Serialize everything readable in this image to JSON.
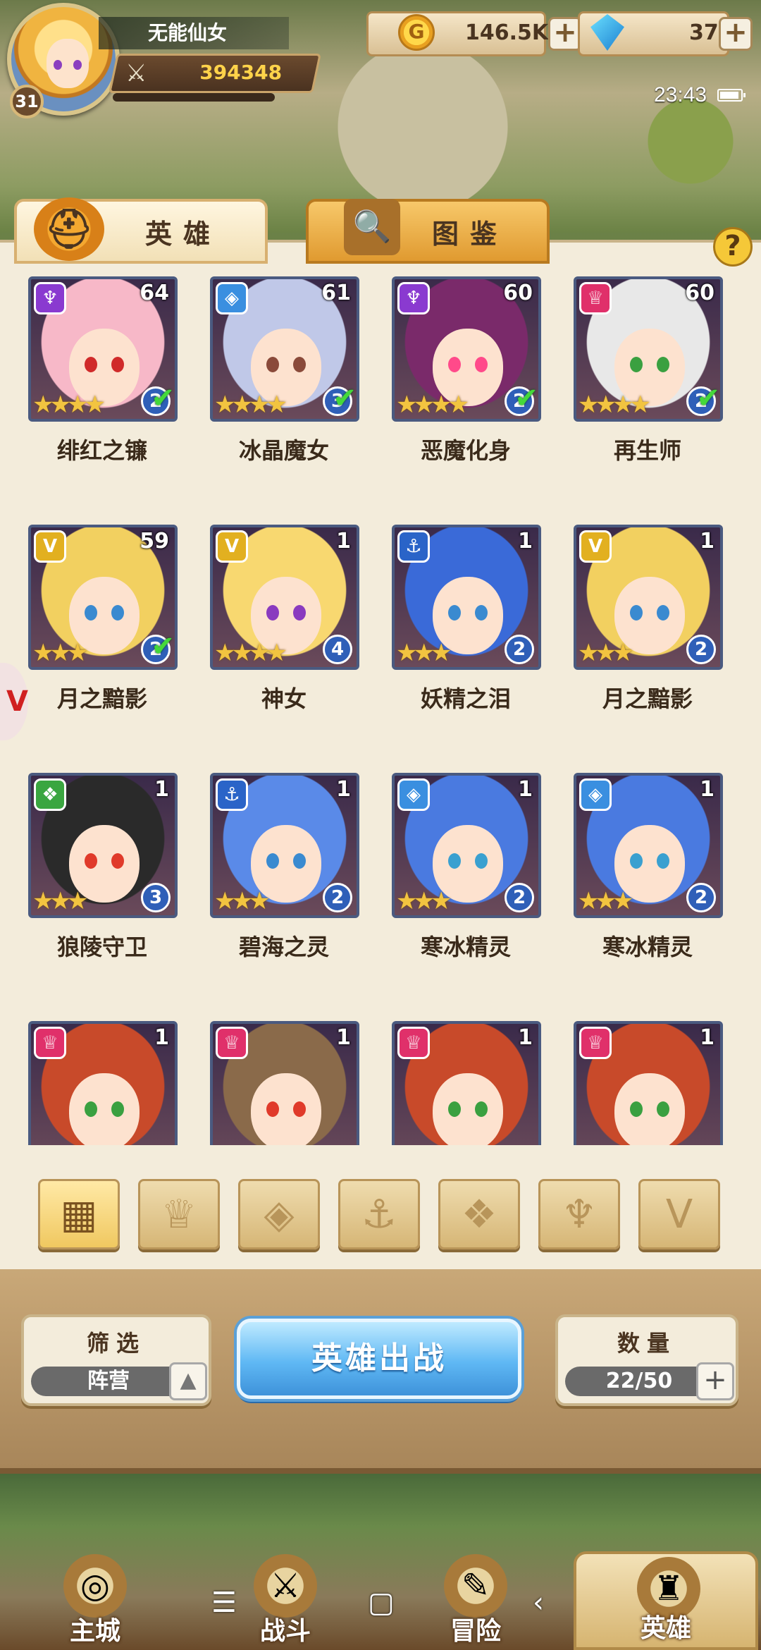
{
  "player": {
    "name": "无能仙女",
    "level": "31",
    "power": "394348"
  },
  "resources": {
    "gold": "146.5K",
    "gems": "37"
  },
  "status": {
    "time": "23:43"
  },
  "tabs": {
    "heroes": "英雄",
    "codex": "图鉴",
    "help": "?"
  },
  "factions": {
    "purple": {
      "color": "#8a3ad0",
      "icon": "horns-icon"
    },
    "blue": {
      "color": "#3a8fe0",
      "icon": "diamond-icon"
    },
    "pink": {
      "color": "#e0306a",
      "icon": "crown-icon"
    },
    "gold": {
      "color": "#e2b020",
      "icon": "chevron-icon"
    },
    "navy": {
      "color": "#2a64c8",
      "icon": "anchor-icon"
    },
    "green": {
      "color": "#3aa640",
      "icon": "beast-icon"
    }
  },
  "heroes": [
    {
      "name": "绯红之镰",
      "level": "64",
      "stars": 4,
      "rank": "2",
      "owned": true,
      "faction": "purple",
      "hair": "#f7b8c8",
      "eye": "#d02a2a"
    },
    {
      "name": "冰晶魔女",
      "level": "61",
      "stars": 4,
      "rank": "3",
      "owned": true,
      "faction": "blue",
      "hair": "#c0c8e8",
      "eye": "#8a4a3a"
    },
    {
      "name": "恶魔化身",
      "level": "60",
      "stars": 4,
      "rank": "2",
      "owned": true,
      "faction": "purple",
      "hair": "#7a2a6a",
      "eye": "#ff4a8a"
    },
    {
      "name": "再生师",
      "level": "60",
      "stars": 4,
      "rank": "2",
      "owned": true,
      "faction": "pink",
      "hair": "#e8e8e8",
      "eye": "#3aa040"
    },
    {
      "name": "月之黯影",
      "level": "59",
      "stars": 3,
      "rank": "2",
      "owned": true,
      "faction": "gold",
      "hair": "#f2d060",
      "eye": "#3a8ad0"
    },
    {
      "name": "神女",
      "level": "1",
      "stars": 4,
      "rank": "4",
      "owned": false,
      "faction": "gold",
      "hair": "#f8d870",
      "eye": "#8a3abf"
    },
    {
      "name": "妖精之泪",
      "level": "1",
      "stars": 3,
      "rank": "2",
      "owned": false,
      "faction": "navy",
      "hair": "#3a6ad8",
      "eye": "#3a8ad0"
    },
    {
      "name": "月之黯影",
      "level": "1",
      "stars": 3,
      "rank": "2",
      "owned": false,
      "faction": "gold",
      "hair": "#f2d060",
      "eye": "#3a8ad0"
    },
    {
      "name": "狼陵守卫",
      "level": "1",
      "stars": 3,
      "rank": "3",
      "owned": false,
      "faction": "green",
      "hair": "#2a2a2a",
      "eye": "#e03a2a"
    },
    {
      "name": "碧海之灵",
      "level": "1",
      "stars": 3,
      "rank": "2",
      "owned": false,
      "faction": "navy",
      "hair": "#5a8ae8",
      "eye": "#3a8ad0"
    },
    {
      "name": "寒冰精灵",
      "level": "1",
      "stars": 3,
      "rank": "2",
      "owned": false,
      "faction": "blue",
      "hair": "#4a7ae0",
      "eye": "#3aa0d0"
    },
    {
      "name": "寒冰精灵",
      "level": "1",
      "stars": 3,
      "rank": "2",
      "owned": false,
      "faction": "blue",
      "hair": "#4a7ae0",
      "eye": "#3aa0d0"
    },
    {
      "name": "",
      "level": "1",
      "stars": 0,
      "rank": "",
      "owned": false,
      "faction": "pink",
      "hair": "#c84a2a",
      "eye": "#3aa040"
    },
    {
      "name": "",
      "level": "1",
      "stars": 0,
      "rank": "",
      "owned": false,
      "faction": "pink",
      "hair": "#8a6a4a",
      "eye": "#e03a2a"
    },
    {
      "name": "",
      "level": "1",
      "stars": 0,
      "rank": "",
      "owned": false,
      "faction": "pink",
      "hair": "#c84a2a",
      "eye": "#3aa040"
    },
    {
      "name": "",
      "level": "1",
      "stars": 0,
      "rank": "",
      "owned": false,
      "faction": "pink",
      "hair": "#c84a2a",
      "eye": "#3aa040"
    }
  ],
  "filters": [
    {
      "icon": "grid-icon",
      "glyph": "▦",
      "active": true
    },
    {
      "icon": "crown-icon",
      "glyph": "♕",
      "active": false
    },
    {
      "icon": "diamond-icon",
      "glyph": "◈",
      "active": false
    },
    {
      "icon": "anchor-icon",
      "glyph": "⚓",
      "active": false
    },
    {
      "icon": "beast-icon",
      "glyph": "❖",
      "active": false
    },
    {
      "icon": "horns-icon",
      "glyph": "♆",
      "active": false
    },
    {
      "icon": "chevron-icon",
      "glyph": "V",
      "active": false
    }
  ],
  "controls": {
    "filter_title": "筛选",
    "filter_value": "阵营",
    "deploy": "英雄出战",
    "count_title": "数量",
    "count_value": "22/50"
  },
  "nav": [
    {
      "label": "主城",
      "icon": "castle-icon",
      "glyph": "◎"
    },
    {
      "label": "战斗",
      "icon": "crossed-swords-icon",
      "glyph": "⚔"
    },
    {
      "label": "冒险",
      "icon": "scroll-icon",
      "glyph": "✎"
    },
    {
      "label": "英雄",
      "icon": "helmet-icon",
      "glyph": "♜"
    }
  ]
}
